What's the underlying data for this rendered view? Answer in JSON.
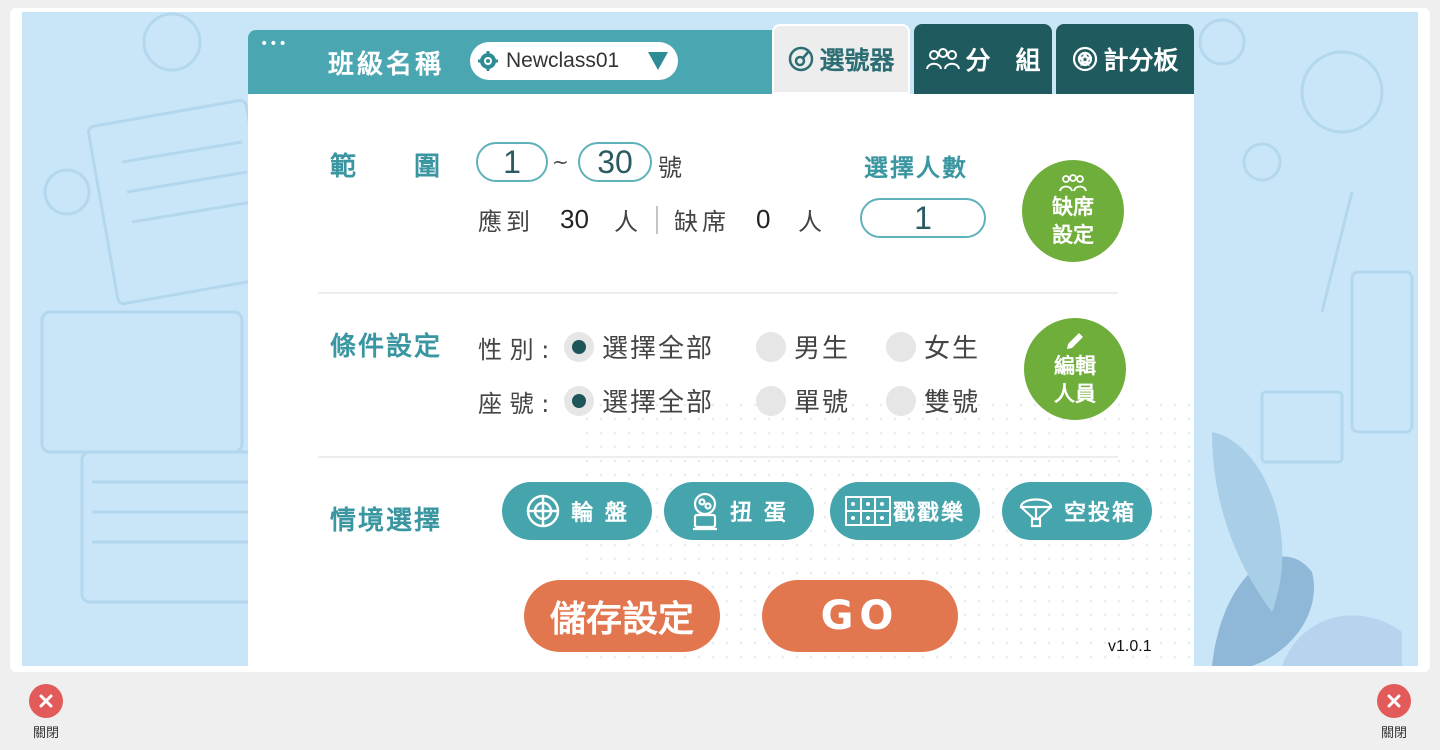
{
  "header": {
    "dots": "•••",
    "class_label": "班級名稱",
    "class_value": "Newclass01",
    "tabs": [
      {
        "label": "選號器",
        "icon": "picker-icon",
        "active": true
      },
      {
        "label": "分　組",
        "icon": "group-icon",
        "active": false
      },
      {
        "label": "計分板",
        "icon": "scoreboard-icon",
        "active": false
      }
    ]
  },
  "range": {
    "label": "範　　圍",
    "from": "1",
    "tilde": "~",
    "to": "30",
    "suffix": "號",
    "expected_label": "應到",
    "expected_value": "30",
    "absent_label": "缺席",
    "absent_value": "0",
    "person_unit": "人",
    "count_label": "選擇人數",
    "count_value": "1",
    "absent_setting_line1": "缺席",
    "absent_setting_line2": "設定"
  },
  "conditions": {
    "label": "條件設定",
    "gender_label": "性 別 :",
    "gender_options": [
      "選擇全部",
      "男生",
      "女生"
    ],
    "gender_selected": 0,
    "seat_label": "座 號 :",
    "seat_options": [
      "選擇全部",
      "單號",
      "雙號"
    ],
    "seat_selected": 0,
    "edit_line1": "編輯",
    "edit_line2": "人員"
  },
  "scenario": {
    "label": "情境選擇",
    "options": [
      {
        "label": "輪 盤",
        "icon": "roulette-icon"
      },
      {
        "label": "扭 蛋",
        "icon": "gacha-icon"
      },
      {
        "label": "戳戳樂",
        "icon": "poke-grid-icon"
      },
      {
        "label": "空投箱",
        "icon": "airdrop-icon"
      }
    ]
  },
  "actions": {
    "save": "儲存設定",
    "go": "GO"
  },
  "version": "v1.0.1",
  "close": {
    "label": "關閉"
  },
  "colors": {
    "teal": "#4aa7b2",
    "dark_teal": "#1f5a5f",
    "green": "#6fae3b",
    "orange": "#e2764f",
    "background": "#c9e6f8"
  }
}
